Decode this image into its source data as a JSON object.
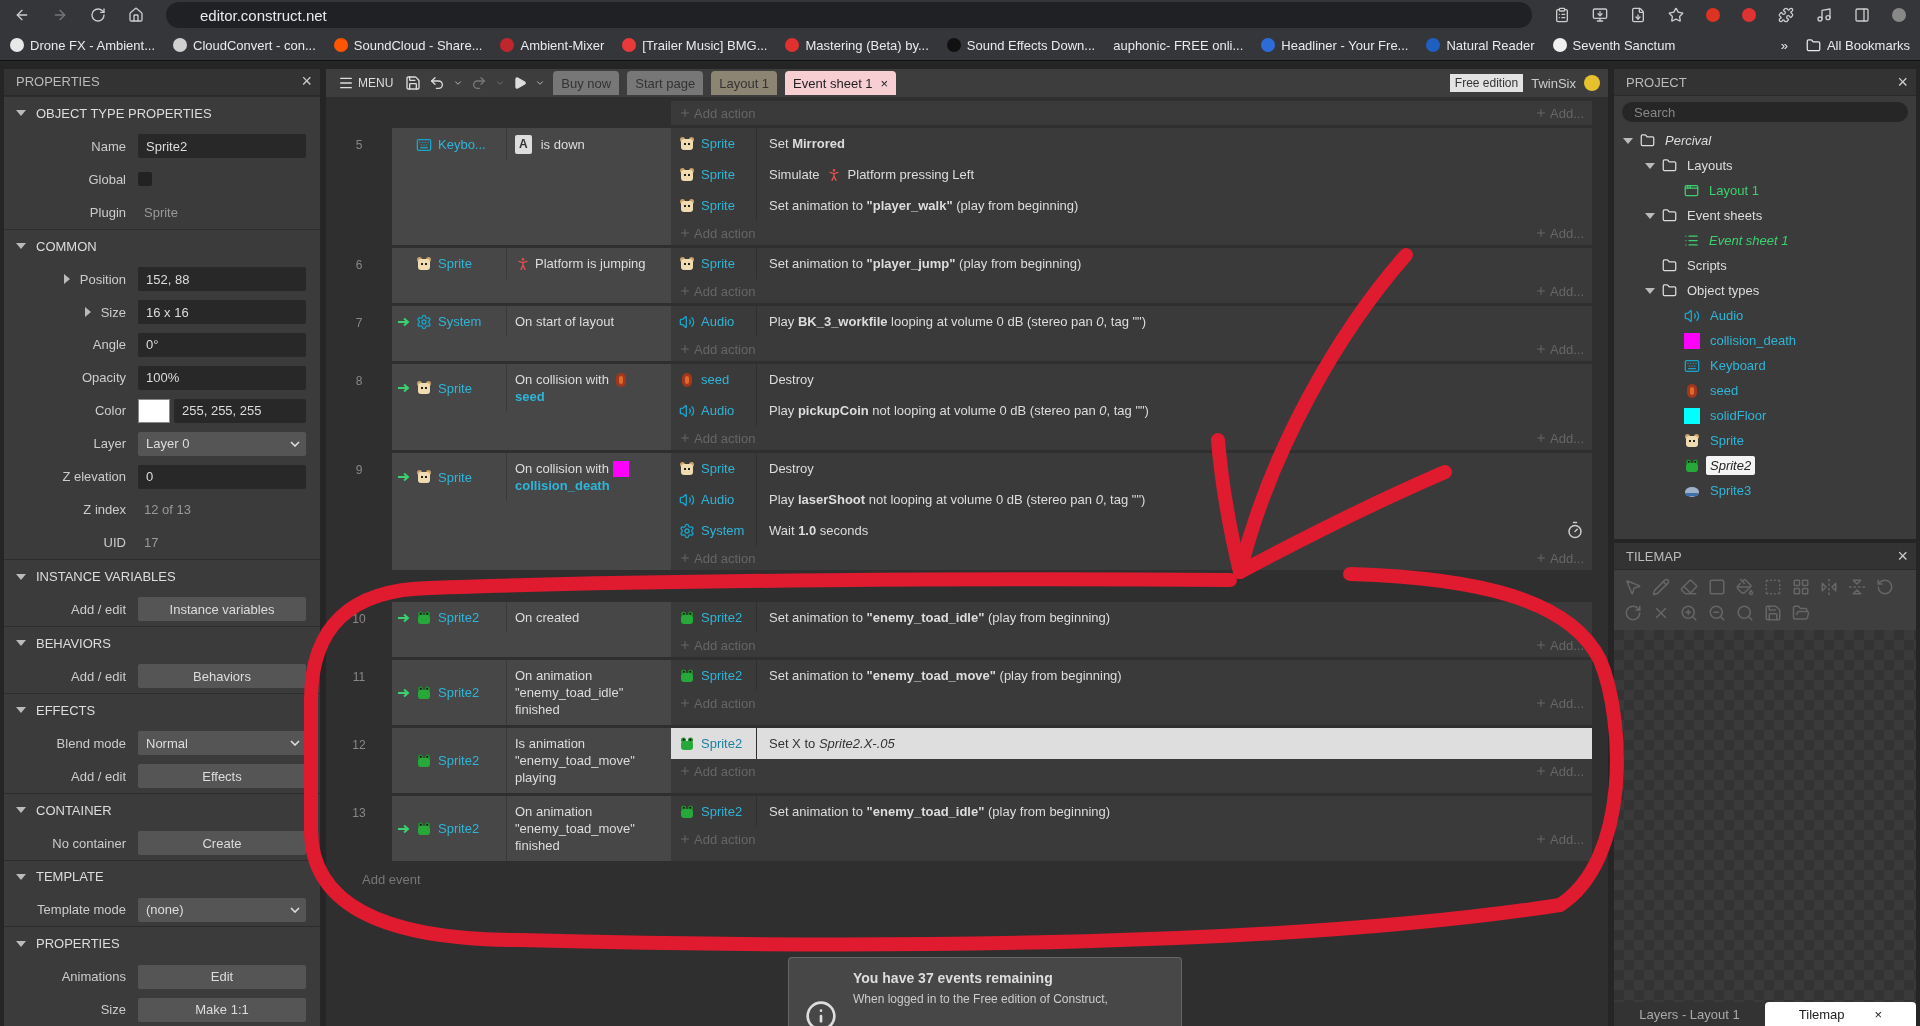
{
  "browser": {
    "url": "editor.construct.net",
    "bookmarks": [
      {
        "label": "Drone FX - Ambient...",
        "color": "#e8e8e8"
      },
      {
        "label": "CloudConvert - con...",
        "color": "#d0d0d0"
      },
      {
        "label": "SoundCloud - Share...",
        "color": "#ff5500"
      },
      {
        "label": "Ambient-Mixer",
        "color": "#c0262d"
      },
      {
        "label": "[Trailer Music] BMG...",
        "color": "#e83a3a"
      },
      {
        "label": "Mastering (Beta) by...",
        "color": "#e03030"
      },
      {
        "label": "Sound Effects Down...",
        "color": "#111111"
      },
      {
        "label": "auphonic- FREE onli..."
      },
      {
        "label": "Headliner - Your Fre...",
        "color": "#2d6bd8"
      },
      {
        "label": "Natural Reader",
        "color": "#1f5fbf"
      },
      {
        "label": "Seventh Sanctum",
        "color": "#f0f0f0"
      }
    ],
    "more": "»",
    "all_bookmarks": "All Bookmarks"
  },
  "properties": {
    "title": "PROPERTIES",
    "close": "×",
    "sections": [
      {
        "title": "OBJECT TYPE PROPERTIES",
        "expanded": true,
        "rows": [
          {
            "label": "Name",
            "kind": "field",
            "value": "Sprite2"
          },
          {
            "label": "Global",
            "kind": "checkbox",
            "checked": false
          },
          {
            "label": "Plugin",
            "kind": "static",
            "value": "Sprite"
          }
        ]
      },
      {
        "title": "COMMON",
        "expanded": true,
        "rows": [
          {
            "label": "Position",
            "kind": "field",
            "value": "152, 88",
            "expanded": false
          },
          {
            "label": "Size",
            "kind": "field",
            "value": "16 x 16",
            "expanded": false
          },
          {
            "label": "Angle",
            "kind": "field",
            "value": "0°"
          },
          {
            "label": "Opacity",
            "kind": "field",
            "value": "100%"
          },
          {
            "label": "Color",
            "kind": "color",
            "value": "255, 255, 255",
            "color": "#ffffff"
          },
          {
            "label": "Layer",
            "kind": "select",
            "value": "Layer 0"
          },
          {
            "label": "Z elevation",
            "kind": "field",
            "value": "0"
          },
          {
            "label": "Z index",
            "kind": "static",
            "value": "12 of 13"
          },
          {
            "label": "UID",
            "kind": "static",
            "value": "17"
          }
        ]
      },
      {
        "title": "INSTANCE VARIABLES",
        "expanded": true,
        "rows": [
          {
            "label": "Add / edit",
            "kind": "button",
            "value": "Instance variables"
          }
        ]
      },
      {
        "title": "BEHAVIORS",
        "expanded": true,
        "rows": [
          {
            "label": "Add / edit",
            "kind": "button",
            "value": "Behaviors"
          }
        ]
      },
      {
        "title": "EFFECTS",
        "expanded": true,
        "rows": [
          {
            "label": "Blend mode",
            "kind": "select",
            "value": "Normal"
          },
          {
            "label": "Add / edit",
            "kind": "button",
            "value": "Effects"
          }
        ]
      },
      {
        "title": "CONTAINER",
        "expanded": true,
        "rows": [
          {
            "label": "No container",
            "kind": "button",
            "value": "Create"
          }
        ]
      },
      {
        "title": "TEMPLATE",
        "expanded": true,
        "rows": [
          {
            "label": "Template mode",
            "kind": "select",
            "value": "(none)"
          }
        ]
      },
      {
        "title": "PROPERTIES",
        "expanded": true,
        "rows": [
          {
            "label": "Animations",
            "kind": "button",
            "value": "Edit"
          },
          {
            "label": "Size",
            "kind": "button",
            "value": "Make 1:1"
          }
        ]
      }
    ]
  },
  "toolbar": {
    "menu": "MENU",
    "tabs": [
      {
        "label": "Buy now",
        "kind": "page",
        "selected": false
      },
      {
        "label": "Start page",
        "kind": "page",
        "selected": false
      },
      {
        "label": "Layout 1",
        "kind": "layout",
        "selected": false
      },
      {
        "label": "Event sheet 1",
        "kind": "sheet",
        "selected": true,
        "close": "×"
      }
    ],
    "edition": "Free edition",
    "user": "TwinSix"
  },
  "event_sheet": {
    "partial": {
      "add_action": "Add action",
      "add_other": "Add..."
    },
    "events": [
      {
        "number": "5",
        "trigger": false,
        "timer": false,
        "condition": {
          "object": {
            "name": "Keybo...",
            "kind": "keyboard"
          },
          "kind": "key",
          "key": "A",
          "text": "is down"
        },
        "actions": [
          {
            "object": {
              "name": "Sprite",
              "kind": "sprite"
            },
            "kind": "plain",
            "text": "Set **Mirrored**",
            "selected": false
          },
          {
            "object": {
              "name": "Sprite",
              "kind": "sprite"
            },
            "kind": "behavior",
            "text": "Simulate",
            "text_after": "Platform pressing Left",
            "selected": false
          },
          {
            "object": {
              "name": "Sprite",
              "kind": "sprite"
            },
            "kind": "plain",
            "text": "Set animation to **\"player_walk\"** (play from beginning)",
            "selected": false
          }
        ],
        "add_action": "Add action",
        "add_other": "Add..."
      },
      {
        "number": "6",
        "trigger": false,
        "timer": false,
        "condition": {
          "object": {
            "name": "Sprite",
            "kind": "sprite"
          },
          "kind": "behavior",
          "text": "Platform is jumping"
        },
        "actions": [
          {
            "object": {
              "name": "Sprite",
              "kind": "sprite"
            },
            "kind": "plain",
            "text": "Set animation to **\"player_jump\"** (play from beginning)",
            "selected": false
          }
        ],
        "add_action": "Add action",
        "add_other": "Add..."
      },
      {
        "number": "7",
        "trigger": true,
        "timer": false,
        "condition": {
          "object": {
            "name": "System",
            "kind": "system"
          },
          "kind": "plain",
          "text": "On start of layout"
        },
        "actions": [
          {
            "object": {
              "name": "Audio",
              "kind": "audio"
            },
            "kind": "plain",
            "text": "Play **BK_3_workfile** looping at volume 0 dB (stereo pan *0*, tag \"\")",
            "selected": false
          }
        ],
        "add_action": "Add action",
        "add_other": "Add..."
      },
      {
        "number": "8",
        "trigger": true,
        "timer": false,
        "condition": {
          "object": {
            "name": "Sprite",
            "kind": "sprite"
          },
          "kind": "collision",
          "text": "On collision with",
          "param": {
            "name": "seed",
            "kind": "seed"
          }
        },
        "actions": [
          {
            "object": {
              "name": "seed",
              "kind": "seed"
            },
            "kind": "plain",
            "text": "Destroy",
            "selected": false
          },
          {
            "object": {
              "name": "Audio",
              "kind": "audio"
            },
            "kind": "plain",
            "text": "Play **pickupCoin** not looping at volume 0 dB (stereo pan *0*, tag \"\")",
            "selected": false
          }
        ],
        "add_action": "Add action",
        "add_other": "Add..."
      },
      {
        "number": "9",
        "trigger": true,
        "timer": true,
        "condition": {
          "object": {
            "name": "Sprite",
            "kind": "sprite"
          },
          "kind": "collision",
          "text": "On collision with",
          "param": {
            "name": "collision_death",
            "kind": "magenta_box"
          }
        },
        "actions": [
          {
            "object": {
              "name": "Sprite",
              "kind": "sprite"
            },
            "kind": "plain",
            "text": "Destroy",
            "selected": false
          },
          {
            "object": {
              "name": "Audio",
              "kind": "audio"
            },
            "kind": "plain",
            "text": "Play **laserShoot** not looping at volume 0 dB (stereo pan *0*, tag \"\")",
            "selected": false
          },
          {
            "object": {
              "name": "System",
              "kind": "system"
            },
            "kind": "plain",
            "text": "Wait **1.0** seconds",
            "selected": false
          }
        ],
        "add_action": "Add action",
        "add_other": "Add..."
      },
      {
        "number": "10",
        "group_start": true,
        "trigger": true,
        "timer": false,
        "condition": {
          "object": {
            "name": "Sprite2",
            "kind": "frog"
          },
          "kind": "plain",
          "text": "On created"
        },
        "actions": [
          {
            "object": {
              "name": "Sprite2",
              "kind": "frog"
            },
            "kind": "plain",
            "text": "Set animation to **\"enemy_toad_idle\"** (play from beginning)",
            "selected": false
          }
        ],
        "add_action": "Add action",
        "add_other": "Add..."
      },
      {
        "number": "11",
        "trigger": true,
        "timer": false,
        "condition": {
          "object": {
            "name": "Sprite2",
            "kind": "frog"
          },
          "kind": "plain",
          "text": "On animation \"enemy_toad_idle\" finished"
        },
        "actions": [
          {
            "object": {
              "name": "Sprite2",
              "kind": "frog"
            },
            "kind": "plain",
            "text": "Set animation to **\"enemy_toad_move\"** (play from beginning)",
            "selected": false
          }
        ],
        "add_action": "Add action",
        "add_other": "Add..."
      },
      {
        "number": "12",
        "trigger": false,
        "timer": false,
        "condition": {
          "object": {
            "name": "Sprite2",
            "kind": "frog"
          },
          "kind": "plain",
          "text": "Is animation \"enemy_toad_move\" playing"
        },
        "actions": [
          {
            "object": {
              "name": "Sprite2",
              "kind": "frog"
            },
            "kind": "plain",
            "text": "Set X to *Sprite2.X-.05*",
            "selected": true
          }
        ],
        "add_action": "Add action",
        "add_other": "Add..."
      },
      {
        "number": "13",
        "trigger": true,
        "timer": false,
        "condition": {
          "object": {
            "name": "Sprite2",
            "kind": "frog"
          },
          "kind": "plain",
          "text": "On animation \"enemy_toad_move\" finished"
        },
        "actions": [
          {
            "object": {
              "name": "Sprite2",
              "kind": "frog"
            },
            "kind": "plain",
            "text": "Set animation to **\"enemy_toad_idle\"** (play from beginning)",
            "selected": false
          }
        ],
        "add_action": "Add action",
        "add_other": "Add..."
      }
    ],
    "add_event": "Add event",
    "notice": {
      "title": "You have 37 events remaining",
      "text": "When logged in to the Free edition of Construct,"
    }
  },
  "project": {
    "title": "PROJECT",
    "close": "×",
    "search": {
      "placeholder": "Search"
    },
    "tree": [
      {
        "label": "Percival",
        "kind": "project",
        "expanded": true,
        "selected": false,
        "children": [
          {
            "label": "Layouts",
            "kind": "folder",
            "expanded": true,
            "selected": false,
            "children": [
              {
                "label": "Layout 1",
                "kind": "layout",
                "selected": false
              }
            ]
          },
          {
            "label": "Event sheets",
            "kind": "folder",
            "expanded": true,
            "selected": false,
            "children": [
              {
                "label": "Event sheet 1",
                "kind": "sheet",
                "selected": false
              }
            ]
          },
          {
            "label": "Scripts",
            "kind": "folder",
            "selected": false
          },
          {
            "label": "Object types",
            "kind": "folder",
            "expanded": true,
            "selected": false,
            "children": [
              {
                "label": "Audio",
                "kind": "audio",
                "selected": false
              },
              {
                "label": "collision_death",
                "kind": "magenta_box",
                "selected": false
              },
              {
                "label": "Keyboard",
                "kind": "keyboard",
                "selected": false
              },
              {
                "label": "seed",
                "kind": "seed",
                "selected": false
              },
              {
                "label": "solidFloor",
                "kind": "cyan_box",
                "selected": false
              },
              {
                "label": "Sprite",
                "kind": "sprite",
                "selected": false
              },
              {
                "label": "Sprite2",
                "kind": "frog",
                "selected": true
              },
              {
                "label": "Sprite3",
                "kind": "sprite3",
                "selected": false
              }
            ]
          }
        ]
      }
    ]
  },
  "tilemap": {
    "title": "TILEMAP",
    "close": "×",
    "tabs": [
      {
        "label": "Layers - Layout 1",
        "selected": false
      },
      {
        "label": "Tilemap",
        "selected": true,
        "close": "×"
      }
    ]
  }
}
